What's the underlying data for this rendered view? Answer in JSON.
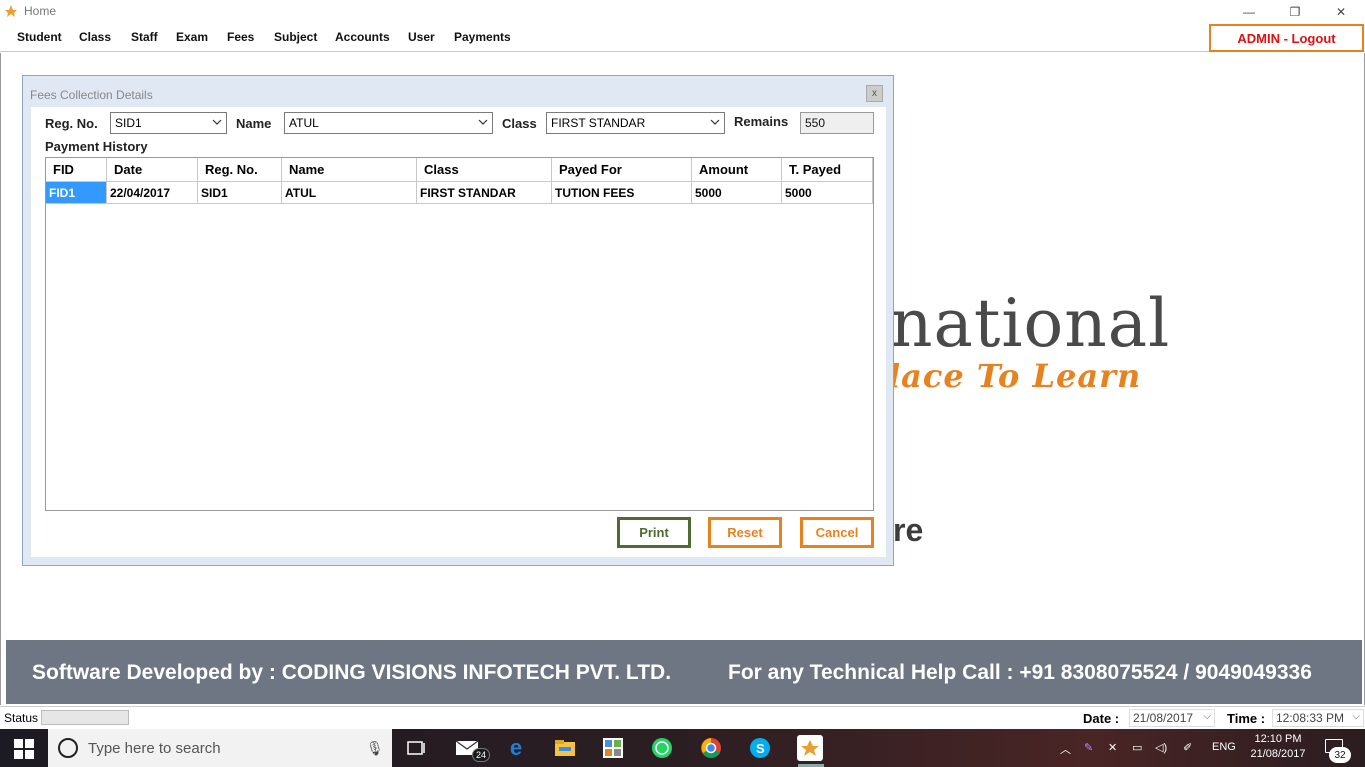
{
  "window": {
    "title": "Home",
    "min_glyph": "—",
    "max_glyph": "❐",
    "close_glyph": "✕"
  },
  "menu": {
    "items": [
      "Student",
      "Class",
      "Staff",
      "Exam",
      "Fees",
      "Subject",
      "Accounts",
      "User",
      "Payments"
    ],
    "logout_label": "ADMIN - Logout"
  },
  "background": {
    "logo_main": "national",
    "logo_sub": "lace To Learn",
    "partial_text": "re",
    "footer_left": "Software Developed by : CODING VISIONS INFOTECH PVT. LTD.",
    "footer_right": "For any Technical Help Call : +91 8308075524 / 9049049336"
  },
  "dialog": {
    "title": "Fees Collection Details",
    "close_glyph": "x",
    "regno_label": "Reg. No.",
    "regno_value": "SID1",
    "name_label": "Name",
    "name_value": "ATUL",
    "class_label": "Class",
    "class_value": "FIRST STANDAR",
    "remains_label": "Remains",
    "remains_value": "550",
    "history_label": "Payment History",
    "columns": [
      "FID",
      "Date",
      "Reg. No.",
      "Name",
      "Class",
      "Payed For",
      "Amount",
      "T. Payed"
    ],
    "rows": [
      [
        "FID1",
        "22/04/2017",
        "SID1",
        "ATUL",
        "FIRST STANDAR",
        "TUTION FEES",
        "5000",
        "5000"
      ]
    ],
    "print_label": "Print",
    "reset_label": "Reset",
    "cancel_label": "Cancel"
  },
  "statusbar": {
    "status_label": "Status",
    "date_label": "Date :",
    "date_value": "21/08/2017",
    "time_label": "Time :",
    "time_value": "12:08:33 PM"
  },
  "taskbar": {
    "search_placeholder": "Type here to search",
    "mail_badge": "24",
    "language": "ENG",
    "clock_time": "12:10 PM",
    "clock_date": "21/08/2017",
    "notification_count": "32"
  },
  "colors": {
    "accent_orange": "#e8821e",
    "logout_text": "#e01010",
    "print_green": "#4f6b33",
    "selection_blue": "#3399ff",
    "footer_bg": "#6e7683"
  }
}
